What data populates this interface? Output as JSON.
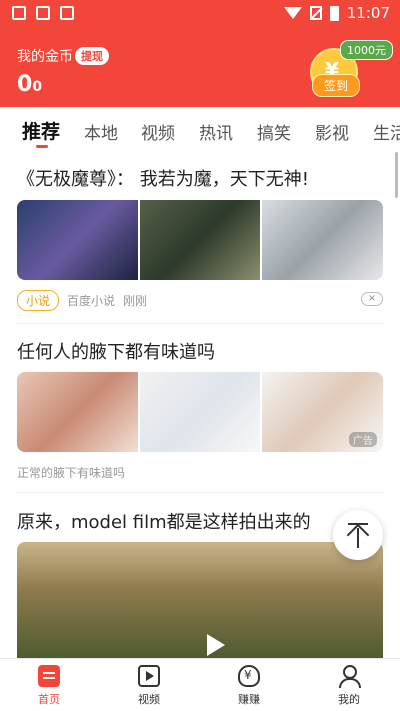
{
  "status_bar": {
    "time": "11:07"
  },
  "header": {
    "coin_title": "我的金币",
    "withdraw_label": "提现",
    "coin_amount": "0",
    "coin_unit": "0",
    "bonus_badge": "1000元",
    "checkin_label": "签到",
    "coin_symbol": "¥"
  },
  "tabs": [
    "推荐",
    "本地",
    "视频",
    "热讯",
    "搞笑",
    "影视",
    "生活"
  ],
  "articles": [
    {
      "title": "《无极魔尊》： 我若为魔，天下无神!",
      "tag": "小说",
      "source": "百度小说",
      "time": "刚刚"
    },
    {
      "title": "任何人的腋下都有味道吗",
      "ad_label": "广告",
      "description": "正常的腋下有味道吗"
    },
    {
      "title": "原来，model film都是这样拍出来的"
    }
  ],
  "close_label": "×",
  "bottom_nav": [
    {
      "label": "首页"
    },
    {
      "label": "视频"
    },
    {
      "label": "赚赚"
    },
    {
      "label": "我的"
    }
  ],
  "colors": {
    "brand": "#f3463a",
    "tag": "#f5b02a"
  }
}
